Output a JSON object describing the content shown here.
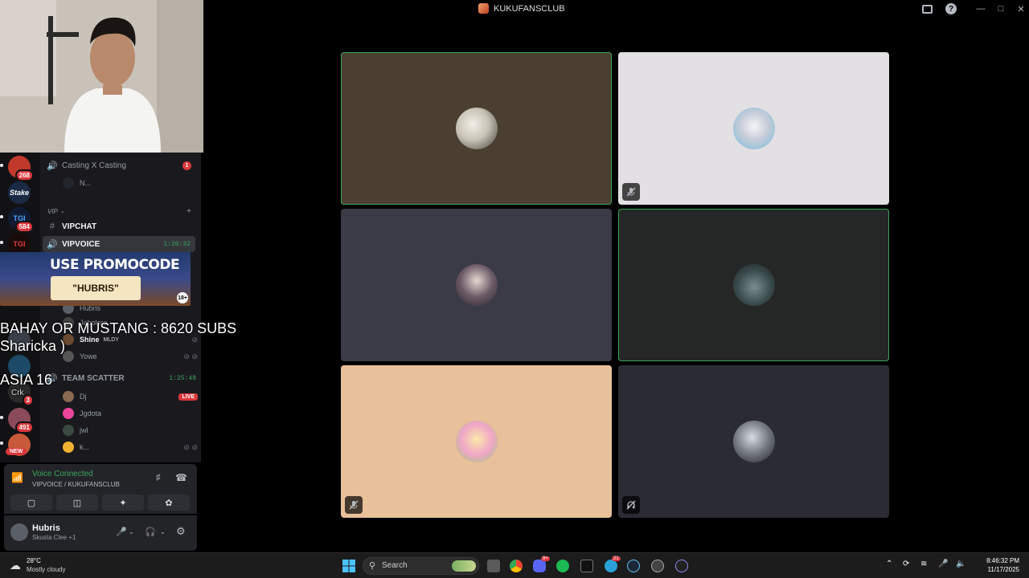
{
  "window": {
    "title": "KUKUFANSCLUB"
  },
  "video_tiles": [
    {
      "name": "tile-1",
      "bg": "#4a3f30",
      "speaking": true,
      "muted": false
    },
    {
      "name": "tile-2",
      "bg": "#e3e0e4",
      "speaking": false,
      "muted": true
    },
    {
      "name": "tile-3",
      "bg": "#3b3a47",
      "speaking": false,
      "muted": false
    },
    {
      "name": "tile-4",
      "bg": "#252726",
      "speaking": true,
      "muted": false
    },
    {
      "name": "tile-5",
      "bg": "#e8c09a",
      "speaking": false,
      "muted": true
    },
    {
      "name": "tile-6",
      "bg": "#2b2b33",
      "speaking": false,
      "muted": false
    }
  ],
  "servers": {
    "badge1": "268",
    "label_stake": "Stake",
    "badge2": "584",
    "badge3": "3",
    "badge4": "491",
    "new_label": "NEW"
  },
  "channels": {
    "casting": "Casting X Casting",
    "casting_badge": "1",
    "casting_user": "N...",
    "category_vip": "VIP",
    "vipchat": "VIPCHAT",
    "vipvoice": "VIPVOICE",
    "vipvoice_timer": "1:20:32",
    "user_hubris": "Hubris",
    "user_jabolero": "Jabolero",
    "user_shine": "Shine",
    "shine_tag": "MLDY",
    "user_yowe": "Yowe",
    "team_scatter": "TEAM SCATTER",
    "team_scatter_timer": "1:25:48",
    "user_dj": "Dj",
    "live_label": "LIVE",
    "user_jgdota": "Jgdota",
    "user_jwl": "jwl",
    "user_k": "k..."
  },
  "promo": {
    "line1": "USE PROMOCODE",
    "line2": "\"HUBRIS\"",
    "age": "18+"
  },
  "overlay": {
    "goal": "BAHAY OR MUSTANG : 8620 SUBS",
    "name": "Sharicka )",
    "region": "ASIA 16",
    "crk": "Crk"
  },
  "voice": {
    "status": "Voice Connected",
    "location": "VIPVOICE / KUKUFANSCLUB"
  },
  "user": {
    "name": "Hubris",
    "status": "Skusta Clee +1"
  },
  "taskbar": {
    "weather_temp": "28°C",
    "weather_desc": "Mostly cloudy",
    "search_placeholder": "Search",
    "time": "8:46:32 PM",
    "date": "11/17/2025",
    "discord_badge": "9+",
    "app_badge": "21"
  },
  "colors": {
    "speaking": "#3ba55c",
    "live": "#da373c",
    "sidebar": "#1a1a1e",
    "rail": "#121214"
  }
}
